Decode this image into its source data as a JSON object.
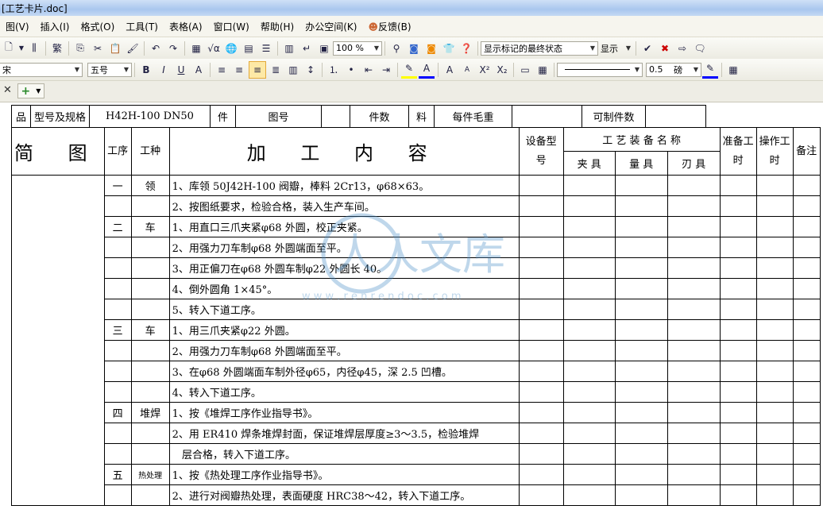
{
  "window": {
    "title": "[工艺卡片.doc]"
  },
  "menu": [
    "图(V)",
    "插入(I)",
    "格式(O)",
    "工具(T)",
    "表格(A)",
    "窗口(W)",
    "帮助(H)",
    "办公空间(K)",
    "反馈(B)"
  ],
  "toolbar1": {
    "zoom": "100 %",
    "track_mode": "显示标记的最终状态",
    "show_label": "显示"
  },
  "toolbar2": {
    "style": "宋",
    "font_size": "五号",
    "line_weight": "0.5",
    "line_unit": "磅"
  },
  "header_row": {
    "pin": "品",
    "model_label": "型号及规格",
    "model_value": "H42H-100 DN50",
    "jian": "件",
    "drawing_label": "图号",
    "count_label": "件数",
    "liao": "料",
    "weight_label": "每件毛重",
    "makeable_label": "可制件数"
  },
  "table_head": {
    "sketch": "简  图",
    "process": "工序",
    "kind": "工种",
    "content": "加 工 内 容",
    "equip_model": "设备型号",
    "tooling": "工 艺 装 备 名 称",
    "fixture": "夹 具",
    "gauge": "量 具",
    "cutter": "刃 具",
    "prep_time": "准备工时",
    "op_time": "操作工时",
    "remark": "备注"
  },
  "rows": [
    {
      "no": "一",
      "kind": "领",
      "text": "1、库领 50J42H-100 阀瓣，棒料 2Cr13，φ68×63。"
    },
    {
      "no": "",
      "kind": "",
      "text": "2、按图纸要求，检验合格，装入生产车间。"
    },
    {
      "no": "二",
      "kind": "车",
      "text": "1、用直口三爪夹紧φ68 外圆，校正夹紧。"
    },
    {
      "no": "",
      "kind": "",
      "text": "2、用强力刀车制φ68 外圆端面至平。"
    },
    {
      "no": "",
      "kind": "",
      "text": "3、用正偏刀在φ68 外圆车制φ22 外圆长 40。"
    },
    {
      "no": "",
      "kind": "",
      "text": "4、倒外圆角 1×45°。"
    },
    {
      "no": "",
      "kind": "",
      "text": "5、转入下道工序。"
    },
    {
      "no": "三",
      "kind": "车",
      "text": "1、用三爪夹紧φ22 外圆。"
    },
    {
      "no": "",
      "kind": "",
      "text": "2、用强力刀车制φ68 外圆端面至平。"
    },
    {
      "no": "",
      "kind": "",
      "text": "3、在φ68 外圆端面车制外径φ65，内径φ45，深 2.5 凹槽。"
    },
    {
      "no": "",
      "kind": "",
      "text": "4、转入下道工序。"
    },
    {
      "no": "四",
      "kind": "堆焊",
      "text": "1、按《堆焊工序作业指导书》。"
    },
    {
      "no": "",
      "kind": "",
      "text": "2、用 ER410 焊条堆焊封面，保证堆焊层厚度≥3～3.5，检验堆焊"
    },
    {
      "no": "",
      "kind": "",
      "text": "   层合格，转入下道工序。"
    },
    {
      "no": "五",
      "kind": "热处理",
      "text": "1、按《热处理工序作业指导书》。"
    },
    {
      "no": "",
      "kind": "",
      "text": "2、进行对阀瓣热处理，表面硬度 HRC38～42，转入下道工序。"
    }
  ],
  "watermark": {
    "text": "人人文库",
    "url": "w w w . r e n r e n d o c . c o m"
  }
}
